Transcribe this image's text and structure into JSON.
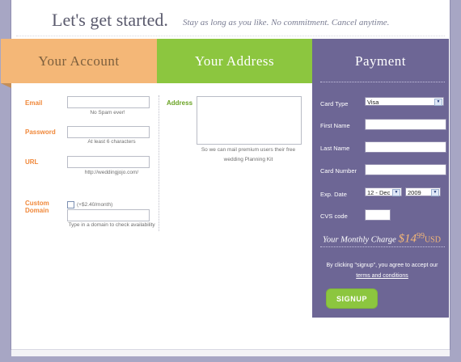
{
  "header": {
    "title": "Let's get started.",
    "subtitle": "Stay as long as you like. No commitment. Cancel anytime."
  },
  "tabs": {
    "account": "Your Account",
    "address": "Your Address",
    "payment": "Payment"
  },
  "account": {
    "email_label": "Email",
    "email_hint": "No Spam ever!",
    "password_label": "Password",
    "password_hint": "At least 6 characters",
    "url_label": "URL",
    "url_hint": "http://weddingjojo.com/",
    "custom_domain_label_line1": "Custom",
    "custom_domain_label_line2": "Domain",
    "custom_domain_price": "(+$2.40/month)",
    "custom_domain_hint": "Type in a domain to check availability"
  },
  "address": {
    "label": "Address",
    "hint_line1": "So we can mail premium users their free",
    "hint_line2": "wedding Planning Kit"
  },
  "payment": {
    "card_type_label": "Card Type",
    "card_type_value": "Visa",
    "first_name_label": "First Name",
    "last_name_label": "Last Name",
    "card_number_label": "Card Number",
    "exp_label": "Exp. Date",
    "exp_month_value": "12 - Dec",
    "exp_year_value": "2009",
    "cvs_label": "CVS code",
    "monthly_charge_label": "Your Monthly Charge",
    "monthly_charge_amount": "$14",
    "monthly_charge_cents": "99",
    "monthly_charge_currency": "USD",
    "terms_text": "By clicking \"signup\", you agree to accept our",
    "terms_link": "terms and conditions",
    "signup_label": "SIGNUP"
  },
  "colors": {
    "account_tab": "#f4b777",
    "address_tab": "#8cc63f",
    "payment_tab": "#6d6695",
    "accent_orange": "#f0883a",
    "accent_green": "#6aa324"
  }
}
